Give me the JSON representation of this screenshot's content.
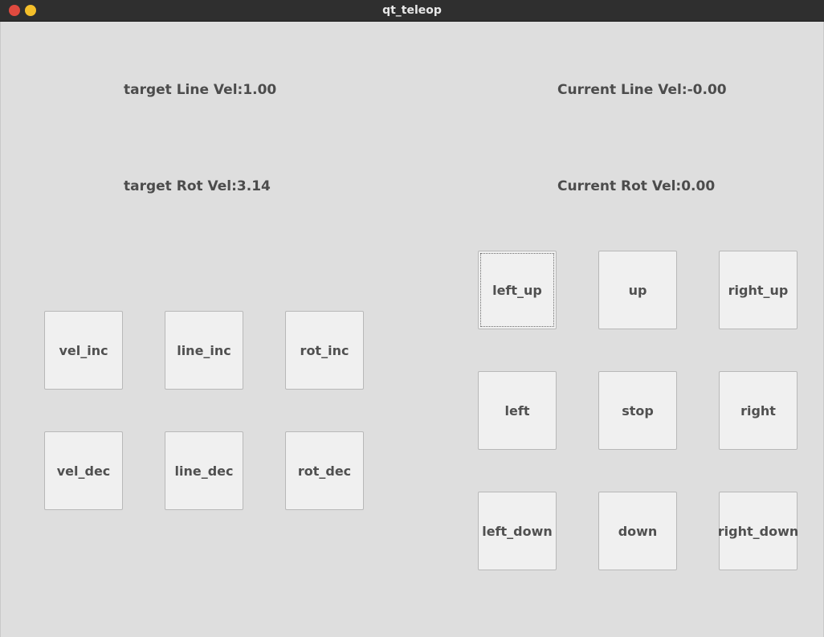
{
  "window": {
    "title": "qt_teleop"
  },
  "labels": {
    "target_line_vel": "target Line Vel:1.00",
    "current_line_vel": "Current Line Vel:-0.00",
    "target_rot_vel": "target Rot Vel:3.14",
    "current_rot_vel": "Current Rot Vel:0.00"
  },
  "speed_buttons": {
    "vel_inc": "vel_inc",
    "line_inc": "line_inc",
    "rot_inc": "rot_inc",
    "vel_dec": "vel_dec",
    "line_dec": "line_dec",
    "rot_dec": "rot_dec"
  },
  "direction_buttons": {
    "left_up": "left_up",
    "up": "up",
    "right_up": "right_up",
    "left": "left",
    "stop": "stop",
    "right": "right",
    "left_down": "left_down",
    "down": "down",
    "right_down": "right_down"
  },
  "colors": {
    "titlebar": "#2f2f2f",
    "close": "#e04a3f",
    "minimize": "#f4bf2a",
    "background": "#dedede",
    "button": "#f0f0f0"
  }
}
